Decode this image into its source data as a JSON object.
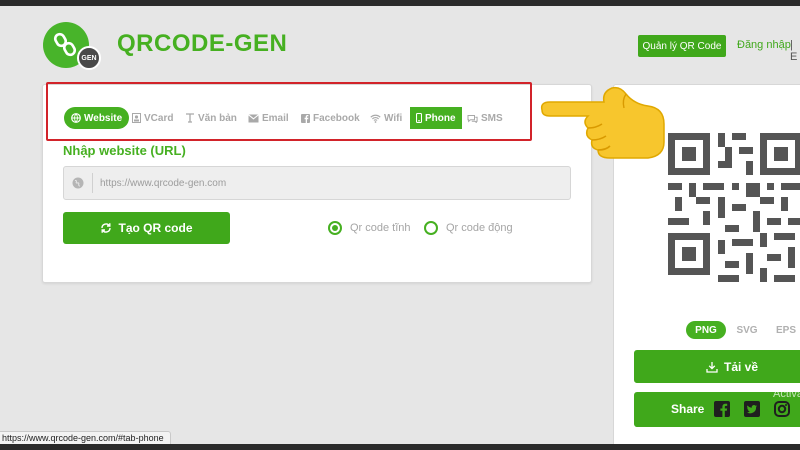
{
  "brand": {
    "name": "QRCODE-GEN",
    "badge": "GEN"
  },
  "header": {
    "manage_label": "Quản lý QR Code",
    "login_label": "Đăng nhập",
    "separator": "| E"
  },
  "tabs": [
    {
      "label": "Website",
      "icon": "globe-icon",
      "active": true
    },
    {
      "label": "VCard",
      "icon": "vcard-icon",
      "active": false
    },
    {
      "label": "Văn bản",
      "icon": "text-icon",
      "active": false
    },
    {
      "label": "Email",
      "icon": "envelope-icon",
      "active": false
    },
    {
      "label": "Facebook",
      "icon": "facebook-icon",
      "active": false
    },
    {
      "label": "Wifi",
      "icon": "wifi-icon",
      "active": false
    },
    {
      "label": "Phone",
      "icon": "phone-icon",
      "active": true
    },
    {
      "label": "SMS",
      "icon": "chat-icon",
      "active": false
    }
  ],
  "form": {
    "url_label": "Nhập website (URL)",
    "url_placeholder": "https://www.qrcode-gen.com",
    "url_value": "",
    "create_label": "Tạo QR code",
    "static_label": "Qr code tĩnh",
    "dynamic_label": "Qr code động",
    "selected_mode": "static"
  },
  "output": {
    "formats": [
      "PNG",
      "SVG",
      "EPS"
    ],
    "active_format": "PNG",
    "download_label": "Tải về",
    "share_label": "Share",
    "share_icons": [
      "facebook-icon",
      "twitter-icon",
      "instagram-icon"
    ]
  },
  "watermark": "Activate",
  "status_url": "https://www.qrcode-gen.com/#tab-phone",
  "colors": {
    "brand_green": "#46b021",
    "highlight_red": "#d2232a",
    "background": "#e6e6e6"
  }
}
